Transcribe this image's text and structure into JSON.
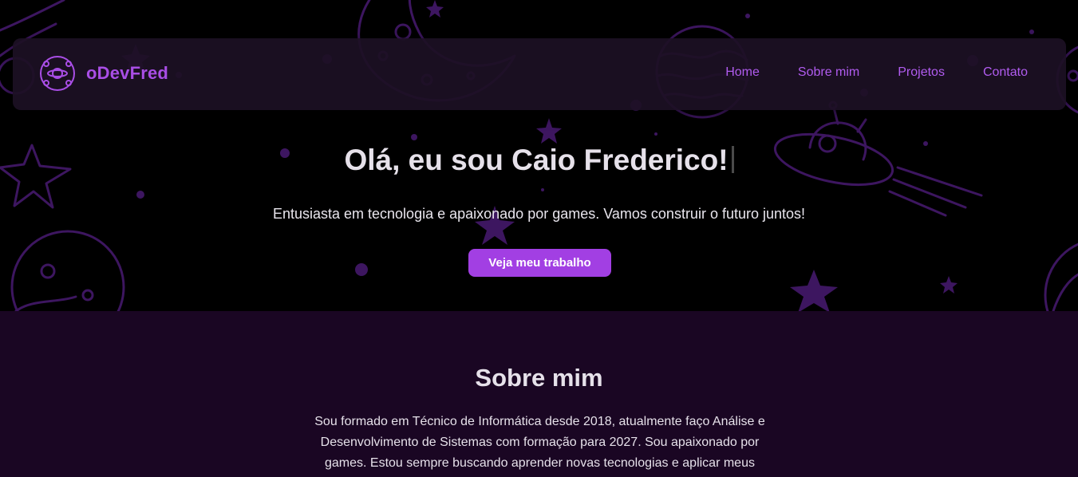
{
  "brand": {
    "name": "oDevFred",
    "logo_icon": "planet-orbit-icon"
  },
  "nav": {
    "links": [
      {
        "label": "Home"
      },
      {
        "label": "Sobre mim"
      },
      {
        "label": "Projetos"
      },
      {
        "label": "Contato"
      }
    ]
  },
  "hero": {
    "title": "Olá, eu sou Caio Frederico!",
    "subtitle": "Entusiasta em tecnologia e apaixonado por games. Vamos construir o futuro juntos!",
    "cta_label": "Veja meu trabalho",
    "background_icons": [
      "moon-icon",
      "planet-icon",
      "ufo-icon",
      "star-icon",
      "comet-icon"
    ]
  },
  "about": {
    "title": "Sobre mim",
    "text": "Sou formado em Técnico de Informática desde 2018, atualmente faço Análise e Desenvolvimento de Sistemas com formação para 2027. Sou apaixonado por games. Estou sempre buscando aprender novas tecnologias e aplicar meus"
  },
  "colors": {
    "accent": "#a23fe3",
    "nav_link": "#b15cf0",
    "brand": "#a94ee6",
    "hero_bg": "#000000",
    "about_bg": "#1a0623",
    "art": "#3d1660"
  }
}
